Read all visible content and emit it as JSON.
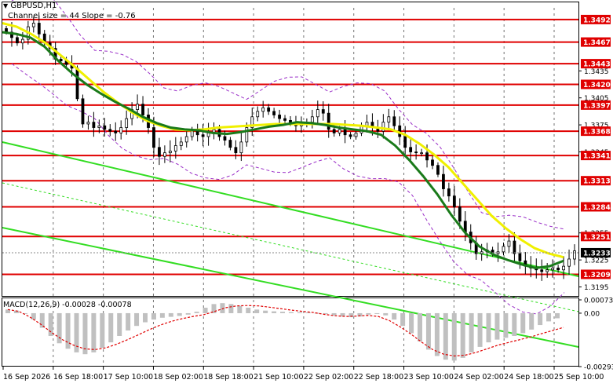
{
  "header": {
    "symbol_label": "GBPUSD,H1",
    "channel_label": "Channel size = 44 Slope = -0.76",
    "indicator_label": "MACD(12,26,9) -0.00028 -0.00078",
    "collapse_icon": "triangle-down-icon"
  },
  "colors": {
    "background": "#ffffff",
    "grid": "#000000",
    "candle": "#000000",
    "ma_slow": "#f0f000",
    "ma_fast": "#1a7a1a",
    "channel": "#33dd22",
    "level": "#e00000",
    "bollinger": "#9b30c8",
    "macd_hist": "#c0c0c0",
    "macd_signal": "#e00000",
    "price_badge": "#000000",
    "level_badge": "#e00000"
  },
  "chart_data": {
    "type": "candlestick",
    "title": "GBPUSD,H1",
    "subtitle": "Channel size = 44 Slope = -0.76",
    "grid": true,
    "ylim": [
      1.3185,
      1.3505
    ],
    "y_ticks": [
      "1.3435",
      "1.3405",
      "1.3375",
      "1.3345",
      "1.3255",
      "1.3225",
      "1.3195"
    ],
    "x_ticks": [
      "16 Sep 2026",
      "16 Sep 18:00",
      "17 Sep 10:00",
      "18 Sep 02:00",
      "18 Sep 18:00",
      "21 Sep 10:00",
      "22 Sep 02:00",
      "22 Sep 18:00",
      "23 Sep 10:00",
      "24 Sep 02:00",
      "24 Sep 18:00",
      "25 Sep 10:00"
    ],
    "levels": [
      "1.3492",
      "1.3467",
      "1.3443",
      "1.3420",
      "1.3397",
      "1.3368",
      "1.3341",
      "1.3313",
      "1.3284",
      "1.3251",
      "1.3209"
    ],
    "current_price": "1.3233",
    "close_series": [
      1.3478,
      1.3472,
      1.3466,
      1.347,
      1.3484,
      1.3488,
      1.3476,
      1.3466,
      1.346,
      1.3448,
      1.3446,
      1.3442,
      1.3438,
      1.3404,
      1.3376,
      1.3378,
      1.3372,
      1.3374,
      1.337,
      1.3368,
      1.3366,
      1.3372,
      1.3382,
      1.3392,
      1.3398,
      1.3386,
      1.3372,
      1.335,
      1.334,
      1.3344,
      1.3346,
      1.3352,
      1.3356,
      1.3362,
      1.3368,
      1.3364,
      1.3362,
      1.3366,
      1.337,
      1.3362,
      1.3358,
      1.335,
      1.3344,
      1.3356,
      1.3372,
      1.3384,
      1.339,
      1.3394,
      1.339,
      1.3386,
      1.3382,
      1.338,
      1.3378,
      1.3374,
      1.3376,
      1.3378,
      1.3384,
      1.3392,
      1.3388,
      1.337,
      1.3366,
      1.337,
      1.3364,
      1.3362,
      1.3366,
      1.3374,
      1.3378,
      1.3372,
      1.3368,
      1.3378,
      1.3384,
      1.3374,
      1.3362,
      1.335,
      1.3345,
      1.3344,
      1.3344,
      1.3336,
      1.333,
      1.332,
      1.3304,
      1.3296,
      1.3284,
      1.3268,
      1.3256,
      1.3244,
      1.3232,
      1.3234,
      1.3236,
      1.3232,
      1.3234,
      1.324,
      1.3246,
      1.3232,
      1.3224,
      1.3218,
      1.3216,
      1.3214,
      1.3212,
      1.3214,
      1.3216,
      1.3214,
      1.3218,
      1.3226,
      1.3235
    ],
    "ma_fast": [
      1.3478,
      1.3476,
      1.3472,
      1.3462,
      1.3446,
      1.3432,
      1.342,
      1.341,
      1.3401,
      1.3393,
      1.3384,
      1.3377,
      1.3372,
      1.337,
      1.3369,
      1.3366,
      1.3365,
      1.3367,
      1.337,
      1.3373,
      1.3375,
      1.3378,
      1.3377,
      1.3375,
      1.3372,
      1.337,
      1.3368,
      1.3364,
      1.3352,
      1.3336,
      1.3318,
      1.3298,
      1.3275,
      1.3255,
      1.324,
      1.3231,
      1.3225,
      1.322,
      1.3216,
      1.3218,
      1.3224
    ],
    "ma_slow": [
      1.3488,
      1.3484,
      1.3476,
      1.3466,
      1.3453,
      1.344,
      1.3426,
      1.3412,
      1.34,
      1.3389,
      1.338,
      1.3374,
      1.337,
      1.3369,
      1.337,
      1.3372,
      1.3373,
      1.3374,
      1.3375,
      1.3376,
      1.3376,
      1.3376,
      1.3376,
      1.3376,
      1.3375,
      1.3374,
      1.3372,
      1.337,
      1.3364,
      1.3354,
      1.3342,
      1.3328,
      1.331,
      1.3292,
      1.3274,
      1.326,
      1.3248,
      1.3238,
      1.3232,
      1.3228
    ],
    "indicator": {
      "name": "MACD(12,26,9)",
      "main_value": "-0.00028",
      "signal_value": "-0.00078",
      "y_ticks": [
        "0.00073",
        "0.00",
        "-0.00293"
      ],
      "ylim": [
        -0.00293,
        0.00073
      ],
      "histogram": [
        0.0002,
        0.00014,
        0.0,
        -0.00035,
        -0.0008,
        -0.00125,
        -0.00165,
        -0.00195,
        -0.00215,
        -0.00225,
        -0.00215,
        -0.0019,
        -0.0016,
        -0.00125,
        -0.00095,
        -0.0007,
        -0.0005,
        -0.00035,
        -0.00025,
        -0.0002,
        -0.00015,
        -8e-05,
        8e-05,
        0.0003,
        0.0005,
        0.00055,
        0.0005,
        0.0004,
        0.0003,
        0.0002,
        0.00014,
        0.0001,
        8e-05,
        6e-05,
        5e-05,
        4e-05,
        2e-05,
        -4e-05,
        -0.00012,
        -0.00018,
        -0.00022,
        -0.00018,
        -8e-05,
        -4e-05,
        -0.00012,
        -0.00035,
        -0.0007,
        -0.0011,
        -0.00155,
        -0.002,
        -0.00235,
        -0.00255,
        -0.0026,
        -0.00245,
        -0.00215,
        -0.00185,
        -0.0016,
        -0.00145,
        -0.00135,
        -0.00125,
        -0.0011,
        -0.0009,
        -0.00065,
        -0.00045,
        -0.00028
      ],
      "signal": [
        0.0002,
        0.0001,
        -0.0002,
        -0.0006,
        -0.00105,
        -0.00145,
        -0.00175,
        -0.00195,
        -0.002,
        -0.0019,
        -0.0017,
        -0.00145,
        -0.00118,
        -0.0009,
        -0.00065,
        -0.00045,
        -0.0003,
        -0.00018,
        -8e-05,
        0.0001,
        0.0003,
        0.0004,
        0.00042,
        0.0004,
        0.00033,
        0.00025,
        0.00017,
        0.0001,
        4e-05,
        -6e-05,
        -0.00014,
        -0.00018,
        -0.00016,
        -0.00012,
        -0.00018,
        -0.0004,
        -0.00075,
        -0.00115,
        -0.0016,
        -0.002,
        -0.00225,
        -0.00235,
        -0.0023,
        -0.00215,
        -0.00195,
        -0.00175,
        -0.0016,
        -0.00145,
        -0.0013,
        -0.00112,
        -0.00095,
        -0.00078
      ]
    }
  }
}
